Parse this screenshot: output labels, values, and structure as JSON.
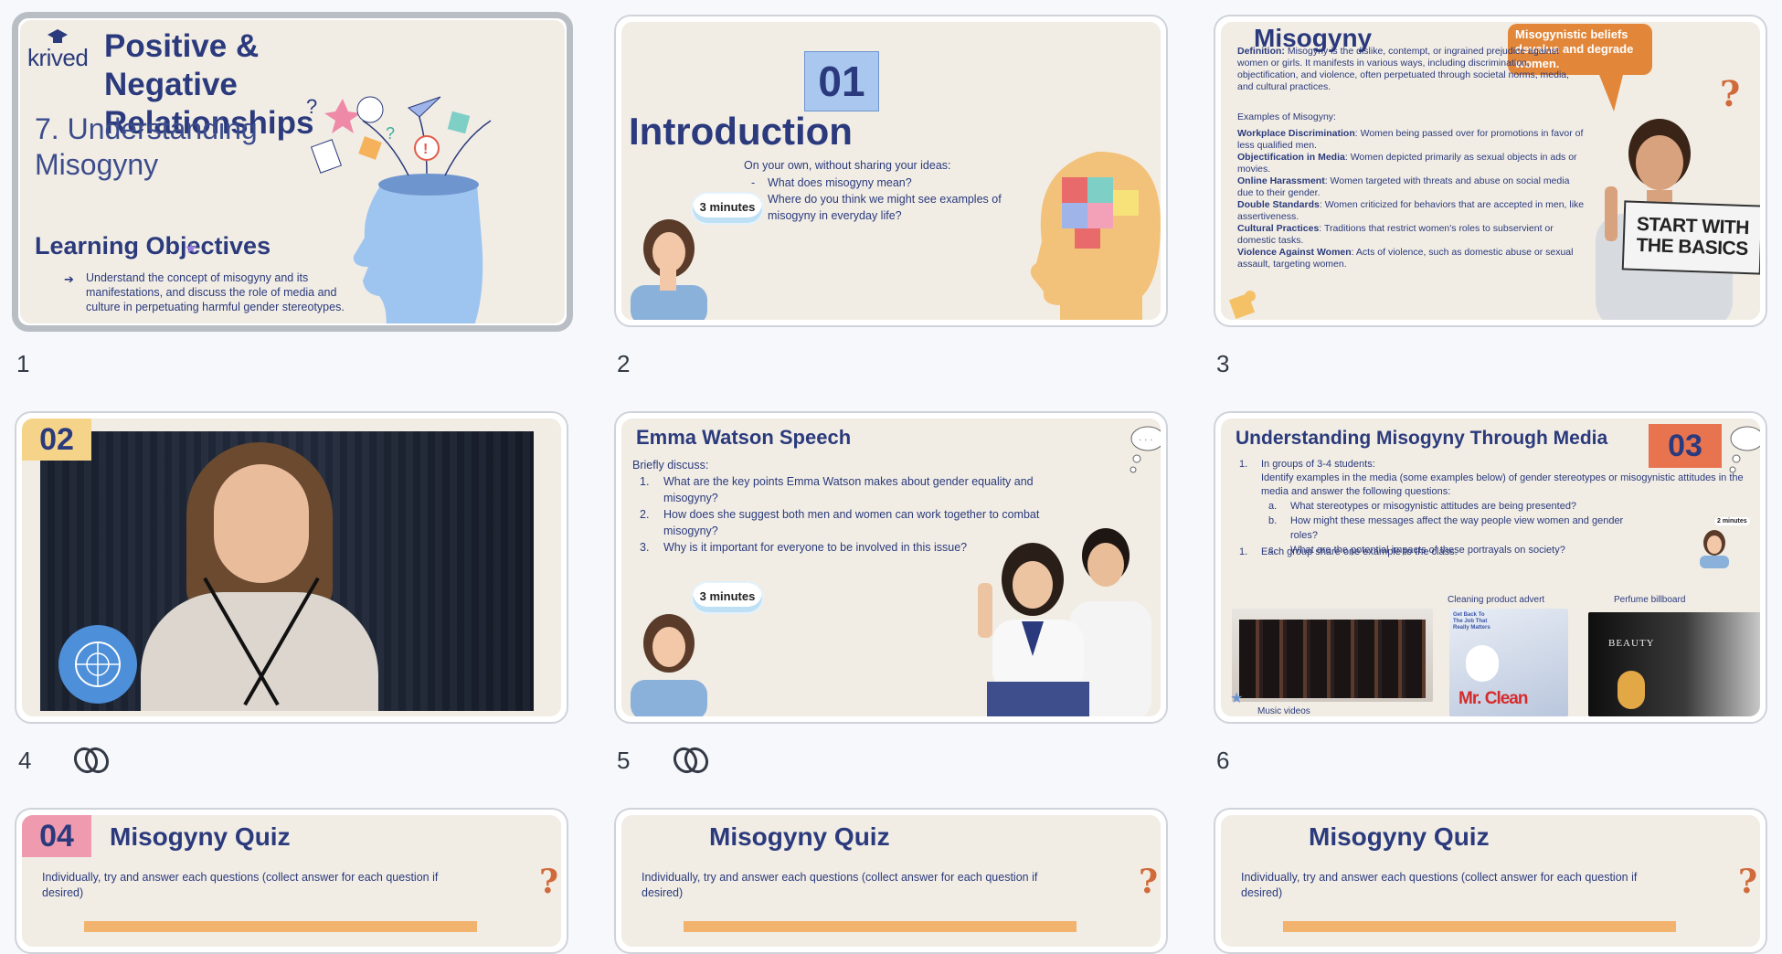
{
  "slides": [
    {
      "number": "1",
      "logo": "krived",
      "title": "Positive & Negative Relationships",
      "subtitle": "7. Understanding Misogyny",
      "section": "Learning Objectives",
      "objective": "Understand the concept of misogyny and its manifestations, and discuss the role of media and culture in perpetuating harmful gender stereotypes."
    },
    {
      "number": "2",
      "badge": "01",
      "title": "Introduction",
      "prompt": "On your own, without sharing your ideas:",
      "bullets": [
        "What does misogyny mean?",
        "Where do you think we might see examples of misogyny in everyday life?"
      ],
      "timer": "3 minutes"
    },
    {
      "number": "3",
      "title": "Misogyny",
      "callout": "Misogynistic beliefs devalue and degrade women.",
      "definition_label": "Definition:",
      "definition": "Misogyny is the dislike, contempt, or ingrained prejudice against women or girls. It manifests in various ways, including discrimination, objectification, and violence, often perpetuated through societal norms, media, and cultural practices.",
      "examples_heading": "Examples of Misogyny:",
      "examples": [
        {
          "label": "Workplace Discrimination",
          "text": ": Women being passed over for promotions in favor of less qualified men."
        },
        {
          "label": "Objectification in Media",
          "text": ": Women depicted primarily as sexual objects in ads or movies."
        },
        {
          "label": "Online Harassment",
          "text": ": Women targeted with threats and abuse on social media due to their gender."
        },
        {
          "label": "Double Standards",
          "text": ": Women criticized for behaviors that are accepted in men, like assertiveness."
        },
        {
          "label": "Cultural Practices",
          "text": ": Traditions that restrict women's roles to subservient or domestic tasks."
        },
        {
          "label": "Violence Against Women",
          "text": ": Acts of violence, such as domestic abuse or sexual assault, targeting women."
        }
      ],
      "sign": "START WITH THE BASICS"
    },
    {
      "number": "4",
      "badge": "02"
    },
    {
      "number": "5",
      "title": "Emma Watson Speech",
      "prompt": "Briefly discuss:",
      "questions": [
        "What are the key points Emma Watson makes about gender equality and misogyny?",
        "How does she suggest both men and women can work together to combat misogyny?",
        "Why is it important for everyone to be involved in this issue?"
      ],
      "timer": "3 minutes"
    },
    {
      "number": "6",
      "title": "Understanding Misogyny Through Media",
      "badge": "03",
      "step1": "In groups of 3-4 students:",
      "instruction": "Identify examples in the media (some examples below) of gender stereotypes or misogynistic attitudes in the media and answer the following questions:",
      "sub": [
        {
          "letter": "a.",
          "text": "What stereotypes or misogynistic attitudes are being presented?"
        },
        {
          "letter": "b.",
          "text": "How might these messages affect the way people view women and gender roles?"
        },
        {
          "letter": "c.",
          "text": "What are the potential impacts of these portrayals on society?"
        }
      ],
      "step2": "Each group share one example to the class.",
      "timer": "2 minutes",
      "captions": {
        "music": "Music videos",
        "cleaning": "Cleaning product advert",
        "perfume": "Perfume billboard"
      },
      "ad_text": "Get Back To The Job That Really Matters",
      "brand": "Mr. Clean",
      "perfume_brand": "BEAUTY"
    },
    {
      "badge": "04",
      "title": "Misogyny Quiz",
      "text": "Individually, try and answer each questions (collect answer for each question if desired)"
    },
    {
      "title": "Misogyny Quiz",
      "text": "Individually, try and answer each questions (collect answer for each question if desired)"
    },
    {
      "title": "Misogyny Quiz",
      "text": "Individually, try and answer each questions (collect answer for each question if desired)"
    }
  ],
  "colors": {
    "navy": "#2b3a7c",
    "orange": "#e2873a",
    "badge_yellow": "#f5d48a",
    "badge_red": "#e8734f",
    "badge_pink": "#f09ab0",
    "badge_blue": "#a9c7ef"
  },
  "icons": [
    "link-icon",
    "question-mark-icon",
    "thought-cloud-icon",
    "puzzle-icon",
    "un-emblem-icon"
  ]
}
